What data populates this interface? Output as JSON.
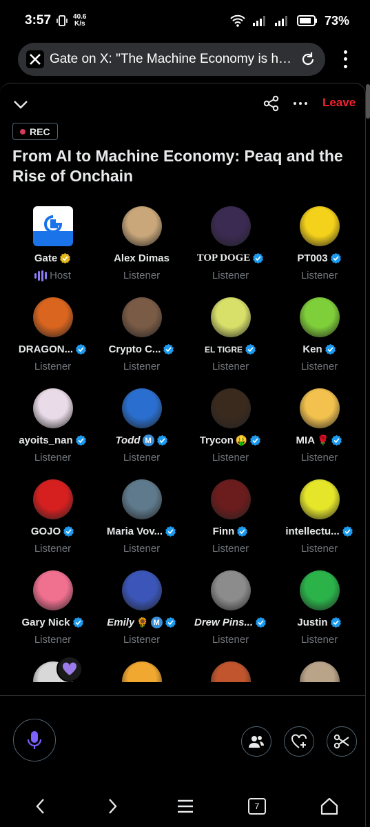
{
  "status_bar": {
    "time": "3:57",
    "net_speed_value": "40.6",
    "net_speed_unit": "K/s",
    "battery": "73%"
  },
  "browser": {
    "page_title": "Gate on X: \"The Machine Economy is he...",
    "icons": [
      "x-logo-icon",
      "reload-icon",
      "overflow-menu-icon"
    ]
  },
  "header": {
    "leave_label": "Leave",
    "rec_label": "REC"
  },
  "space": {
    "title": "From AI to Machine Economy: Peaq and the Rise of Onchain"
  },
  "participants": [
    {
      "name": "Gate",
      "role": "Host",
      "badge": "gold",
      "color": "#1a73e8"
    },
    {
      "name": "Alex Dimas",
      "role": "Listener",
      "badge": "",
      "color": "#c9a77a"
    },
    {
      "name": "TOP DOGE",
      "role": "Listener",
      "badge": "blue",
      "color": "#3b2a52"
    },
    {
      "name": "PT003",
      "role": "Listener",
      "badge": "blue",
      "color": "#f4d11a"
    },
    {
      "name": "DRAGON...",
      "role": "Listener",
      "badge": "blue",
      "color": "#d9651f"
    },
    {
      "name": "Crypto C...",
      "role": "Listener",
      "badge": "blue",
      "color": "#7a5b46"
    },
    {
      "name": "EL TIGRE",
      "role": "Listener",
      "badge": "blue",
      "color": "#d8e06a"
    },
    {
      "name": "Ken",
      "role": "Listener",
      "badge": "blue",
      "color": "#7fcf3a"
    },
    {
      "name": "ayoits_nan",
      "role": "Listener",
      "badge": "blue",
      "color": "#e9dbe7"
    },
    {
      "name": "Todd",
      "role": "Listener",
      "badge": "blue",
      "extra": "M",
      "color": "#2a6fcf"
    },
    {
      "name": "Trycon",
      "role": "Listener",
      "badge": "blue",
      "emoji": "🤑",
      "color": "#3a2a1e"
    },
    {
      "name": "MIA",
      "role": "Listener",
      "badge": "blue",
      "emoji": "🌹",
      "color": "#f2c14e"
    },
    {
      "name": "GOJO",
      "role": "Listener",
      "badge": "blue",
      "color": "#d62020"
    },
    {
      "name": "Maria Vov...",
      "role": "Listener",
      "badge": "blue",
      "color": "#5f7a8c"
    },
    {
      "name": "Finn",
      "role": "Listener",
      "badge": "blue",
      "color": "#6b1c1c"
    },
    {
      "name": "intellectu...",
      "role": "Listener",
      "badge": "blue",
      "color": "#e5e62a"
    },
    {
      "name": "Gary Nick",
      "role": "Listener",
      "badge": "blue",
      "color": "#f07090"
    },
    {
      "name": "Emily",
      "role": "Listener",
      "badge": "blue",
      "emoji": "🌻",
      "extra": "M",
      "color": "#3b56b8"
    },
    {
      "name": "Drew Pins...",
      "role": "Listener",
      "badge": "blue",
      "color": "#8c8c8c"
    },
    {
      "name": "Justin",
      "role": "Listener",
      "badge": "blue",
      "color": "#2bb34a"
    },
    {
      "name": "",
      "role": "",
      "badge": "",
      "color": "#d8d8d8"
    },
    {
      "name": "",
      "role": "",
      "badge": "",
      "color": "#f0a830"
    },
    {
      "name": "",
      "role": "",
      "badge": "",
      "color": "#c0552e"
    },
    {
      "name": "",
      "role": "",
      "badge": "",
      "color": "#b9a48a"
    }
  ],
  "nav": {
    "tab_count": "7"
  },
  "colors": {
    "accent_purple": "#8b7cf6",
    "leave_red": "#f4212e",
    "verified_blue": "#1d9bf0",
    "verified_gold": "#e2b719"
  }
}
